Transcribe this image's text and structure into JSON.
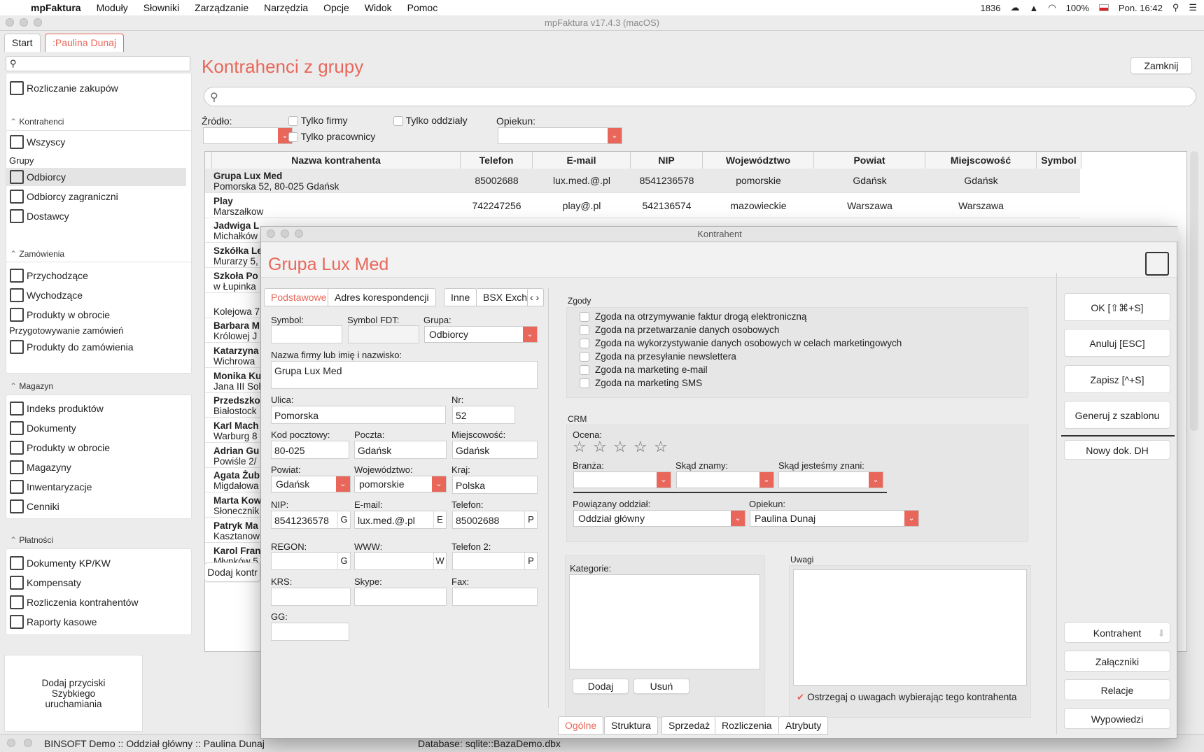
{
  "menubar": {
    "app": "mpFaktura",
    "items": [
      "Moduły",
      "Słowniki",
      "Zarządzanie",
      "Narzędzia",
      "Opcje",
      "Widok",
      "Pomoc"
    ],
    "status_count": "1836",
    "battery": "100%",
    "datetime": "Pon. 16:42"
  },
  "window": {
    "title": "mpFaktura v17.4.3 (macOS)",
    "tabs": [
      "Start",
      ":Paulina Dunaj"
    ]
  },
  "sidebar": {
    "top_item": "Rozliczanie zakupów",
    "kontrahenci": {
      "header": "Kontrahenci",
      "all": "Wszyscy",
      "groups_label": "Grupy",
      "items": [
        "Odbiorcy",
        "Odbiorcy zagraniczni",
        "Dostawcy"
      ]
    },
    "zamowienia": {
      "header": "Zamówienia",
      "items": [
        "Przychodzące",
        "Wychodzące",
        "Produkty w obrocie"
      ],
      "sub_label": "Przygotowywanie zamówień",
      "sub_item": "Produkty do zamówienia"
    },
    "magazyn": {
      "header": "Magazyn",
      "items": [
        "Indeks produktów",
        "Dokumenty",
        "Produkty w obrocie",
        "Magazyny",
        "Inwentaryzacje",
        "Cenniki"
      ]
    },
    "platnosci": {
      "header": "Płatności",
      "items": [
        "Dokumenty KP/KW",
        "Kompensaty",
        "Rozliczenia kontrahentów",
        "Raporty kasowe"
      ]
    },
    "quicklaunch": "Dodaj przyciski Szybkiego uruchamiania"
  },
  "main": {
    "title": "Kontrahenci z grupy",
    "close": "Zamknij",
    "filters": {
      "source_label": "Źródło:",
      "only_companies": "Tylko firmy",
      "only_branches": "Tylko oddziały",
      "only_employees": "Tylko pracownicy",
      "keeper_label": "Opiekun:"
    },
    "columns": [
      "Nazwa kontrahenta",
      "Telefon",
      "E-mail",
      "NIP",
      "Województwo",
      "Powiat",
      "Miejscowość",
      "Symbol kl"
    ],
    "rows": [
      {
        "name": "Grupa Lux Med",
        "addr": "Pomorska 52, 80-025 Gdańsk",
        "phone": "85002688",
        "email": "lux.med.@.pl",
        "nip": "8541236578",
        "woj": "pomorskie",
        "powiat": "Gdańsk",
        "city": "Gdańsk"
      },
      {
        "name": "Play",
        "addr": "Marszałkow",
        "phone": "742247256",
        "email": "play@.pl",
        "nip": "542136574",
        "woj": "mazowieckie",
        "powiat": "Warszawa",
        "city": "Warszawa"
      },
      {
        "name": "Jadwiga L",
        "addr": "Michałków"
      },
      {
        "name": "Szkółka Le",
        "addr": "Murarzy 5,"
      },
      {
        "name": "Szkoła Po",
        "addr": "w Łupinka"
      },
      {
        "name": "",
        "addr": "Kolejowa 7"
      },
      {
        "name": "Barbara M",
        "addr": "Królowej J"
      },
      {
        "name": "Katarzyna",
        "addr": "Wichrowa"
      },
      {
        "name": "Monika Ku",
        "addr": "Jana III Sol"
      },
      {
        "name": "Przedszko",
        "addr": "Białostock"
      },
      {
        "name": "Karl Mach",
        "addr": "Warburg 8"
      },
      {
        "name": "Adrian Gu",
        "addr": "Powiśle 2/"
      },
      {
        "name": "Agata Żub",
        "addr": "Migdałowa"
      },
      {
        "name": "Marta Kow",
        "addr": "Słonecznik"
      },
      {
        "name": "Patryk Ma",
        "addr": "Kasztanow"
      },
      {
        "name": "Karol Fran",
        "addr": "Młynków 5"
      }
    ],
    "add_button": "Dodaj kontr"
  },
  "dialog": {
    "window_title": "Kontrahent",
    "heading": "Grupa Lux Med",
    "tabs": [
      "Podstawowe",
      "Adres korespondencji",
      "Inne",
      "BSX Excha"
    ],
    "labels": {
      "symbol": "Symbol:",
      "symbol_fdt": "Symbol FDT:",
      "grupa": "Grupa:",
      "nazwa": "Nazwa firmy lub imię i nazwisko:",
      "ulica": "Ulica:",
      "nr": "Nr:",
      "kod": "Kod pocztowy:",
      "poczta": "Poczta:",
      "miejscowosc": "Miejscowość:",
      "powiat": "Powiat:",
      "woj": "Województwo:",
      "kraj": "Kraj:",
      "nip": "NIP:",
      "email": "E-mail:",
      "telefon": "Telefon:",
      "regon": "REGON:",
      "www": "WWW:",
      "telefon2": "Telefon 2:",
      "krs": "KRS:",
      "skype": "Skype:",
      "fax": "Fax:",
      "gg": "GG:"
    },
    "values": {
      "grupa": "Odbiorcy",
      "nazwa": "Grupa Lux Med",
      "ulica": "Pomorska",
      "nr": "52",
      "kod": "80-025",
      "poczta": "Gdańsk",
      "miejscowosc": "Gdańsk",
      "powiat": "Gdańsk",
      "woj": "pomorskie",
      "kraj": "Polska",
      "nip": "8541236578",
      "email": "lux.med.@.pl",
      "telefon": "85002688"
    },
    "suffix": {
      "g": "G",
      "e": "E",
      "p": "P",
      "w": "W"
    },
    "zgody": {
      "label": "Zgody",
      "items": [
        "Zgoda na otrzymywanie faktur drogą elektroniczną",
        "Zgoda na przetwarzanie danych osobowych",
        "Zgoda na wykorzystywanie danych osobowych w celach marketingowych",
        "Zgoda na przesyłanie newslettera",
        "Zgoda na marketing e-mail",
        "Zgoda na marketing SMS"
      ]
    },
    "crm": {
      "label": "CRM",
      "ocena": "Ocena:",
      "rating": 0,
      "branza": "Branża:",
      "skad": "Skąd znamy:",
      "skad_nas": "Skąd jesteśmy znani:",
      "oddzial_label": "Powiązany oddział:",
      "oddzial": "Oddział główny",
      "opiekun_label": "Opiekun:",
      "opiekun": "Paulina Dunaj"
    },
    "kategorie": "Kategorie:",
    "add": "Dodaj",
    "remove": "Usuń",
    "uwagi": "Uwagi",
    "warn": "Ostrzegaj o uwagach wybierając tego kontrahenta",
    "bottom_tabs": [
      "Ogólne",
      "Struktura",
      "Sprzedaż",
      "Rozliczenia",
      "Atrybuty"
    ],
    "buttons": [
      "OK [⇧⌘+S]",
      "Anuluj [ESC]",
      "Zapisz [^+S]",
      "Generuj z szablonu",
      "Nowy dok. DH"
    ],
    "side_buttons": [
      "Kontrahent",
      "Załączniki",
      "Relacje",
      "Wypowiedzi"
    ]
  },
  "status": {
    "left": "BINSOFT Demo :: Oddział główny :: Paulina Dunaj",
    "db": "Database: sqlite::BazaDemo.dbx"
  },
  "colors": {
    "accent": "#e8675a"
  }
}
